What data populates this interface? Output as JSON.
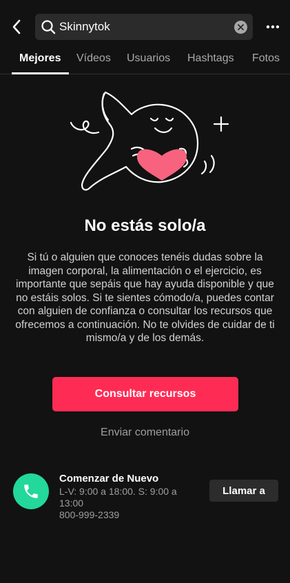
{
  "header": {
    "back_icon": "chevron-left-icon",
    "search": {
      "value": "Skinnytok",
      "icon": "search-icon",
      "clear_icon": "close-icon"
    },
    "more_icon": "more-dots-icon"
  },
  "tabs": [
    {
      "label": "Mejores",
      "active": true
    },
    {
      "label": "Vídeos",
      "active": false
    },
    {
      "label": "Usuarios",
      "active": false
    },
    {
      "label": "Hashtags",
      "active": false
    },
    {
      "label": "Fotos",
      "active": false
    }
  ],
  "content": {
    "illustration_icon": "heart-hug-illustration",
    "title": "No estás solo/a",
    "description": "Si tú o alguien que conoces tenéis dudas sobre la imagen corporal, la alimentación o el ejercicio, es importante que sepáis que hay ayuda disponible y que no estáis solos. Si te sientes cómodo/a, puedes contar con alguien de confianza o consultar los recursos que ofrecemos a continuación. No te olvides de cuidar de ti mismo/a y de los demás.",
    "primary_button": "Consultar recursos",
    "feedback_link": "Enviar comentario"
  },
  "resource": {
    "icon": "phone-icon",
    "name": "Comenzar de Nuevo",
    "hours": "L-V: 9:00 a 18:00. S: 9:00 a 13:00",
    "phone": "800-999-2339",
    "call_button": "Llamar a"
  },
  "colors": {
    "background": "#121212",
    "accent": "#fe2c55",
    "phone_green": "#22d89a",
    "heart_pink": "#f7637f"
  }
}
